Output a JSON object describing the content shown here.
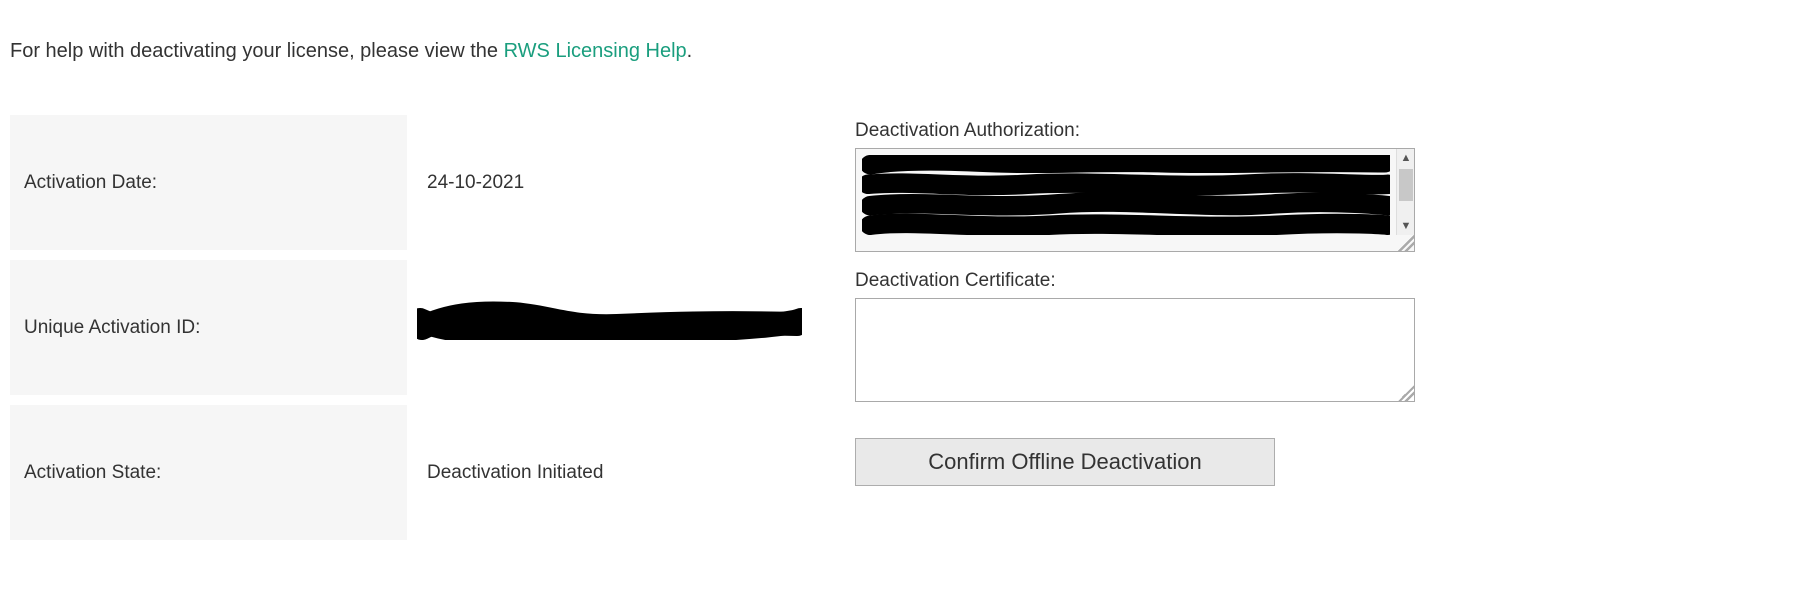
{
  "help": {
    "prefix": "For help with deactivating your license, please view the ",
    "link_text": "RWS Licensing Help",
    "suffix": "."
  },
  "rows": {
    "activation_date": {
      "label": "Activation Date:",
      "value": "24-10-2021"
    },
    "unique_activation_id": {
      "label": "Unique Activation ID:",
      "value": ""
    },
    "activation_state": {
      "label": "Activation State:",
      "value": "Deactivation Initiated"
    }
  },
  "fields": {
    "deactivation_authorization": {
      "label": "Deactivation Authorization:",
      "value": ""
    },
    "deactivation_certificate": {
      "label": "Deactivation Certificate:",
      "value": ""
    }
  },
  "buttons": {
    "confirm_offline_deactivation": "Confirm Offline Deactivation"
  },
  "colors": {
    "link": "#1a9e7e",
    "panel_bg": "#f6f6f6"
  }
}
